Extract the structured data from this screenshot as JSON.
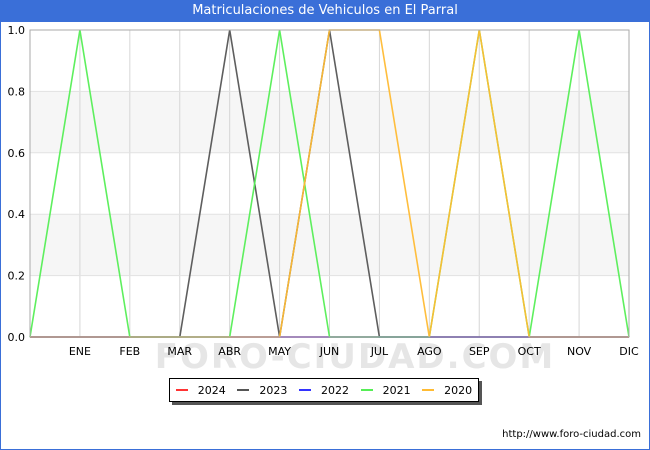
{
  "title": "Matriculaciones de Vehiculos en El Parral",
  "footer_url": "http://www.foro-ciudad.com",
  "watermark": "FORO-CIUDAD.COM",
  "chart_data": {
    "type": "line",
    "categories": [
      "",
      "ENE",
      "FEB",
      "MAR",
      "ABR",
      "MAY",
      "JUN",
      "JUL",
      "AGO",
      "SEP",
      "OCT",
      "NOV",
      "DIC"
    ],
    "ylim": [
      0,
      1.0
    ],
    "yticks": [
      "0.0",
      "0.2",
      "0.4",
      "0.6",
      "0.8",
      "1.0"
    ],
    "grid": true,
    "legend_position": "bottom",
    "series": [
      {
        "name": "2024",
        "color": "#ff3333",
        "values": [
          0,
          0,
          0,
          0,
          0,
          0,
          0,
          0,
          0,
          0,
          0,
          0,
          0
        ]
      },
      {
        "name": "2023",
        "color": "#555555",
        "values": [
          0,
          0,
          0,
          0,
          1,
          0,
          1,
          0,
          0,
          0,
          0,
          0,
          0
        ]
      },
      {
        "name": "2022",
        "color": "#3333ff",
        "values": [
          0,
          0,
          0,
          0,
          0,
          0,
          0,
          0,
          0,
          0,
          0,
          0,
          0
        ]
      },
      {
        "name": "2021",
        "color": "#55ee55",
        "values": [
          0,
          1,
          0,
          0,
          0,
          1,
          0,
          0,
          0,
          1,
          0,
          1,
          0
        ]
      },
      {
        "name": "2020",
        "color": "#ffbb33",
        "values": [
          0,
          0,
          0,
          0,
          0,
          0,
          1,
          1,
          0,
          1,
          0,
          0,
          0
        ]
      }
    ]
  }
}
